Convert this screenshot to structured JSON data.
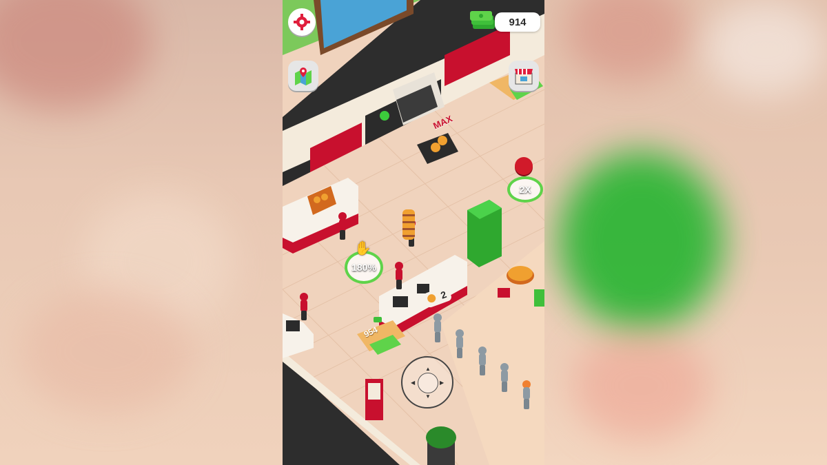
{
  "hud": {
    "cash": "914",
    "settings_icon": "gear-icon",
    "map_icon": "map-pin-icon",
    "shop_icon": "store-icon"
  },
  "world": {
    "station_max_label": "MAX",
    "table_badge": "180%",
    "boost_badge": "2X",
    "counter_queue_count": "2",
    "upgrade_cost": "954"
  },
  "colors": {
    "brand_red": "#c8102e",
    "cash_green": "#3fbf3a",
    "floor": "#f0d3bd"
  }
}
